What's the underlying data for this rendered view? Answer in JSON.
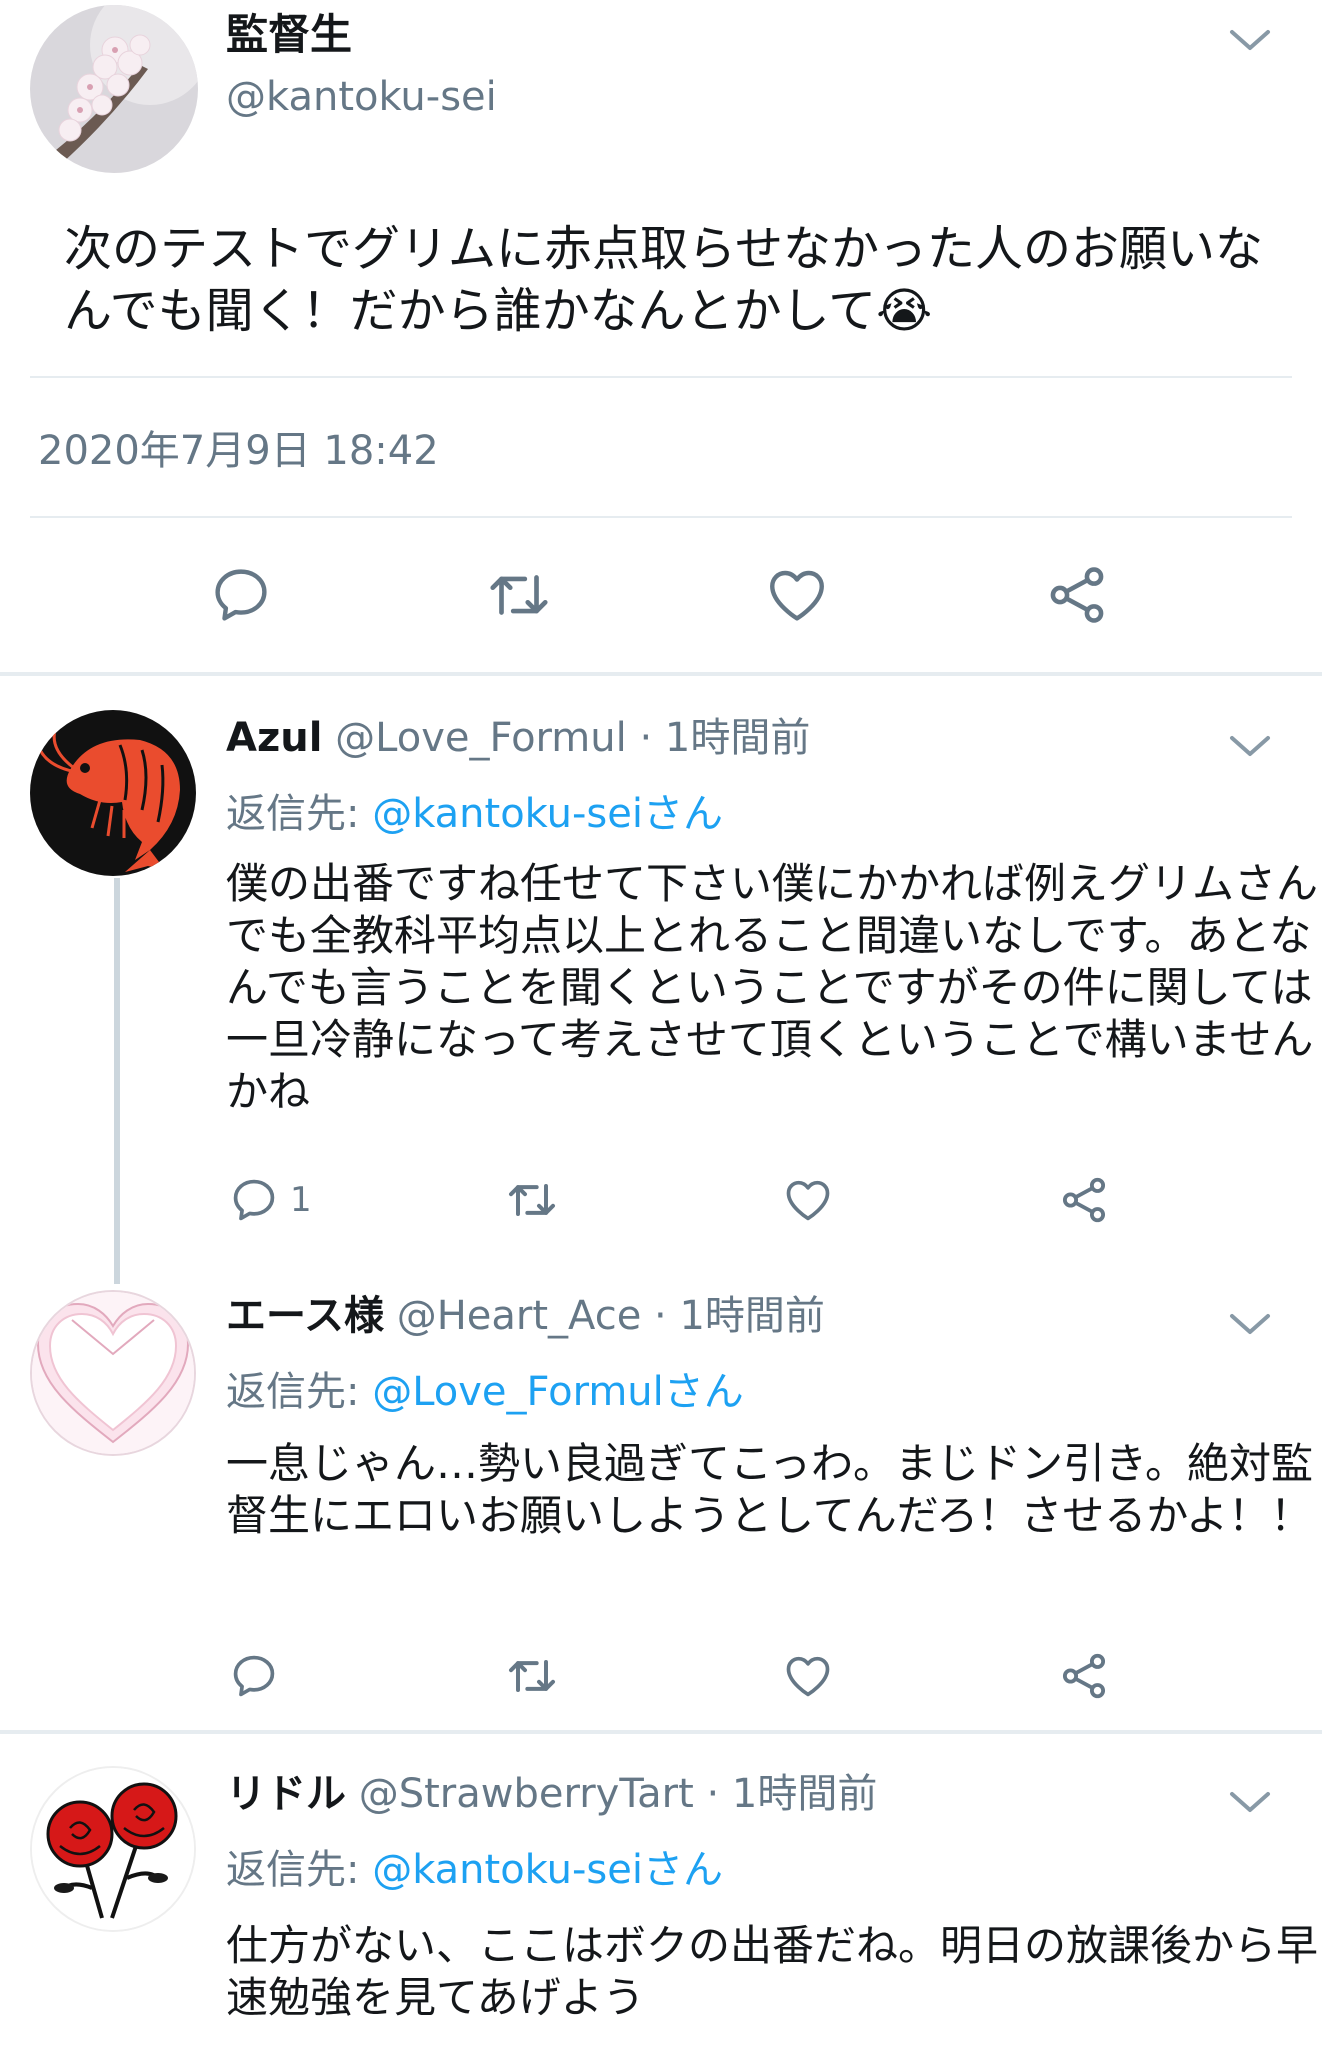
{
  "main_tweet": {
    "display_name": "監督生",
    "handle": "@kantoku-sei",
    "text": "次のテストでグリムに赤点取らせなかった人のお願いなんでも聞く！だから誰かなんとかして😭",
    "timestamp": "2020年7月9日 18:42",
    "avatar_icon": "cherry-blossom-avatar"
  },
  "replies": [
    {
      "display_name": "Azul",
      "handle": "@Love_Formul",
      "time": "· 1時間前",
      "reply_prefix": "返信先: ",
      "reply_to": "@kantoku-seiさん",
      "text": "僕の出番ですね任せて下さい僕にかかれば例えグリムさんでも全教科平均点以上とれること間違いなしです。あとなんでも言うことを聞くということですがその件に関しては一旦冷静になって考えさせて頂くということで構いませんかね",
      "reply_count": "1",
      "avatar_icon": "shrimp-avatar"
    },
    {
      "display_name": "エース様",
      "handle": "@Heart_Ace",
      "time": "· 1時間前",
      "reply_prefix": "返信先: ",
      "reply_to": "@Love_Formulさん",
      "text": "一息じゃん…勢い良過ぎてこっわ。まじドン引き。絶対監督生にエロいお願いしようとしてんだろ！させるかよ！！",
      "reply_count": "",
      "avatar_icon": "heart-avatar"
    },
    {
      "display_name": "リドル",
      "handle": "@StrawberryTart",
      "time": "· 1時間前",
      "reply_prefix": "返信先: ",
      "reply_to": "@kantoku-seiさん",
      "text": "仕方がない、ここはボクの出番だね。明日の放課後から早速勉強を見てあげよう",
      "reply_count": "",
      "avatar_icon": "red-roses-avatar"
    }
  ],
  "colors": {
    "link": "#1da1f2",
    "secondary": "#657786",
    "divider": "#e6ecf0"
  }
}
